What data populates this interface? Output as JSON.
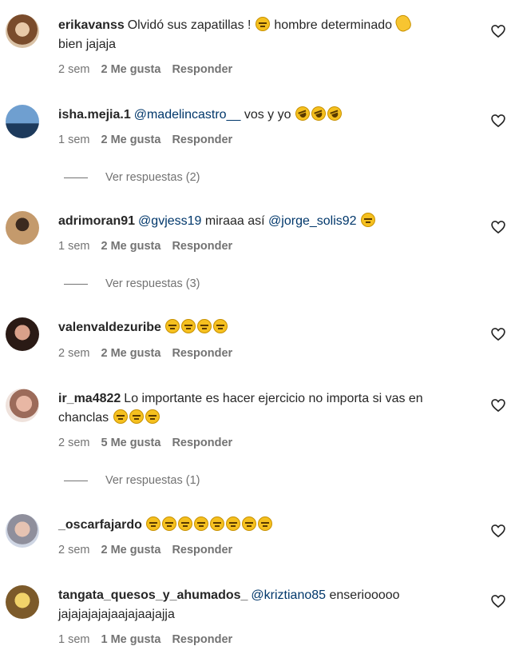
{
  "comments": [
    {
      "username": "erikavanss",
      "text_before": "Olvidó sus zapatillas !",
      "text_after": "hombre determinado",
      "text_tail": "bien jajaja",
      "time": "2 sem",
      "likes": "2 Me gusta",
      "reply": "Responder"
    },
    {
      "username": "isha.mejia.1",
      "mention": "@madelincastro__",
      "text": "vos y yo",
      "time": "1 sem",
      "likes": "2 Me gusta",
      "reply": "Responder",
      "view_replies": "Ver respuestas (2)"
    },
    {
      "username": "adrimoran91",
      "mention": "@gvjess19",
      "text": "miraaa así",
      "mention2": "@jorge_solis92",
      "time": "1 sem",
      "likes": "2 Me gusta",
      "reply": "Responder",
      "view_replies": "Ver respuestas (3)"
    },
    {
      "username": "valenvaldezuribe",
      "time": "2 sem",
      "likes": "2 Me gusta",
      "reply": "Responder"
    },
    {
      "username": "ir_ma4822",
      "text": "Lo importante es hacer ejercicio no importa si vas en",
      "text_tail": "chanclas",
      "time": "2 sem",
      "likes": "5 Me gusta",
      "reply": "Responder",
      "view_replies": "Ver respuestas (1)"
    },
    {
      "username": "_oscarfajardo",
      "time": "2 sem",
      "likes": "2 Me gusta",
      "reply": "Responder"
    },
    {
      "username": "tangata_quesos_y_ahumados_",
      "mention": "@kriztiano85",
      "text": "enseriooooo",
      "text_tail": "jajajajajajaajajaajajja",
      "time": "1 sem",
      "likes": "1 Me gusta",
      "reply": "Responder"
    }
  ],
  "icons": {
    "emoji_neutral": "expressionless-face-emoji",
    "emoji_laugh": "rolling-laughing-emoji",
    "emoji_hand": "waving-hand-emoji",
    "like": "heart-outline-icon"
  },
  "colors": {
    "text": "#262626",
    "muted": "#737373",
    "mention": "#00376b",
    "emoji": "#f5c01f"
  }
}
